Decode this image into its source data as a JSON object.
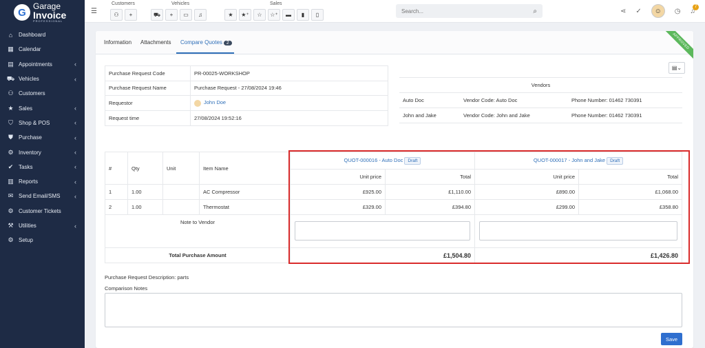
{
  "logo": {
    "line1": "Garage",
    "line2": "Invoice",
    "line3": "PROFESSIONAL",
    "badge": "G"
  },
  "sidebar": {
    "items": [
      {
        "label": "Dashboard",
        "icon": "⌂",
        "chev": false
      },
      {
        "label": "Calendar",
        "icon": "▦",
        "chev": false
      },
      {
        "label": "Appointments",
        "icon": "▤",
        "chev": true
      },
      {
        "label": "Vehicles",
        "icon": "⛟",
        "chev": true
      },
      {
        "label": "Customers",
        "icon": "⚇",
        "chev": false
      },
      {
        "label": "Sales",
        "icon": "★",
        "chev": true
      },
      {
        "label": "Shop & POS",
        "icon": "⛉",
        "chev": true
      },
      {
        "label": "Purchase",
        "icon": "⛊",
        "chev": true
      },
      {
        "label": "Inventory",
        "icon": "⚙",
        "chev": true
      },
      {
        "label": "Tasks",
        "icon": "✔",
        "chev": true
      },
      {
        "label": "Reports",
        "icon": "▥",
        "chev": true
      },
      {
        "label": "Send Email/SMS",
        "icon": "✉",
        "chev": true
      },
      {
        "label": "Customer Tickets",
        "icon": "⚙",
        "chev": false
      },
      {
        "label": "Utilities",
        "icon": "⚒",
        "chev": true
      },
      {
        "label": "Setup",
        "icon": "⚙",
        "chev": false
      }
    ]
  },
  "topbar": {
    "groups": {
      "customers": "Customers",
      "vehicles": "Vehicles",
      "sales": "Sales"
    },
    "search_placeholder": "Search...",
    "notif_count": "7"
  },
  "tabs": {
    "info": "Information",
    "attachments": "Attachments",
    "compare": "Compare Quotes",
    "compare_count": "2"
  },
  "ribbon": "APPROVED",
  "info": {
    "code_label": "Purchase Request Code",
    "code": "PR-00025-WORKSHOP",
    "name_label": "Purchase Request Name",
    "name": "Purchase Request - 27/08/2024 19:46",
    "requestor_label": "Requestor",
    "requestor": "John Doe",
    "time_label": "Request time",
    "time": "27/08/2024 19:52:16"
  },
  "vendors": {
    "title": "Vendors",
    "rows": [
      {
        "name": "Auto Doc",
        "code": "Vendor Code: Auto Doc",
        "phone": "Phone Number: 01462 730391"
      },
      {
        "name": "John and Jake",
        "code": "Vendor Code: John and Jake",
        "phone": "Phone Number: 01462 730391"
      }
    ]
  },
  "items": {
    "headers": {
      "num": "#",
      "qty": "Qty",
      "unit": "Unit",
      "name": "Item Name",
      "unit_price": "Unit price",
      "total": "Total"
    },
    "quotes": [
      {
        "title": "QUOT-000016 - Auto Doc",
        "status": "Draft"
      },
      {
        "title": "QUOT-000017 - John and Jake",
        "status": "Draft"
      }
    ],
    "rows": [
      {
        "num": "1",
        "qty": "1.00",
        "unit": "",
        "name": "AC Compressor",
        "q1_price": "£925.00",
        "q1_total": "£1,110.00",
        "q2_price": "£890.00",
        "q2_total": "£1,068.00"
      },
      {
        "num": "2",
        "qty": "1.00",
        "unit": "",
        "name": "Thermostat",
        "q1_price": "£329.00",
        "q1_total": "£394.80",
        "q2_price": "£299.00",
        "q2_total": "£358.80"
      }
    ],
    "note_label": "Note to Vendor",
    "total_label": "Total Purchase Amount",
    "q1_grand": "£1,504.80",
    "q2_grand": "£1,426.80"
  },
  "description": "Purchase Request Description: parts",
  "comparison_label": "Comparison Notes",
  "save_label": "Save"
}
